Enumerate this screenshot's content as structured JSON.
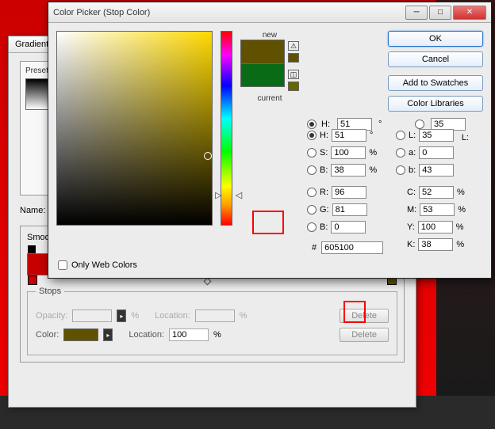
{
  "gradient": {
    "title": "Gradient Editor",
    "presets_label": "Presets",
    "name_label": "Name:",
    "smoothness_label": "Smoothness:",
    "stops": {
      "legend": "Stops",
      "opacity_label": "Opacity:",
      "location_label": "Location:",
      "color_label": "Color:",
      "location_value": "100",
      "pct": "%",
      "delete": "Delete"
    }
  },
  "picker": {
    "title": "Color Picker (Stop Color)",
    "ok": "OK",
    "cancel": "Cancel",
    "add_swatch": "Add to Swatches",
    "libraries": "Color Libraries",
    "new": "new",
    "current": "current",
    "only_web": "Only Web Colors",
    "hex_label": "#",
    "hex": "605100",
    "deg": "°",
    "pct": "%",
    "H": {
      "label": "H:",
      "val": "51"
    },
    "S": {
      "label": "S:",
      "val": "100"
    },
    "Bv": {
      "label": "B:",
      "val": "38"
    },
    "R": {
      "label": "R:",
      "val": "96"
    },
    "G": {
      "label": "G:",
      "val": "81"
    },
    "Bc": {
      "label": "B:",
      "val": "0"
    },
    "L": {
      "label": "L:",
      "val": "35"
    },
    "a": {
      "label": "a:",
      "val": "0"
    },
    "b": {
      "label": "b:",
      "val": "43"
    },
    "C": {
      "label": "C:",
      "val": "52"
    },
    "M": {
      "label": "M:",
      "val": "53"
    },
    "Y": {
      "label": "Y:",
      "val": "100"
    },
    "K": {
      "label": "K:",
      "val": "38"
    }
  },
  "colors": {
    "new": "#605100",
    "current": "#0a6b17"
  }
}
